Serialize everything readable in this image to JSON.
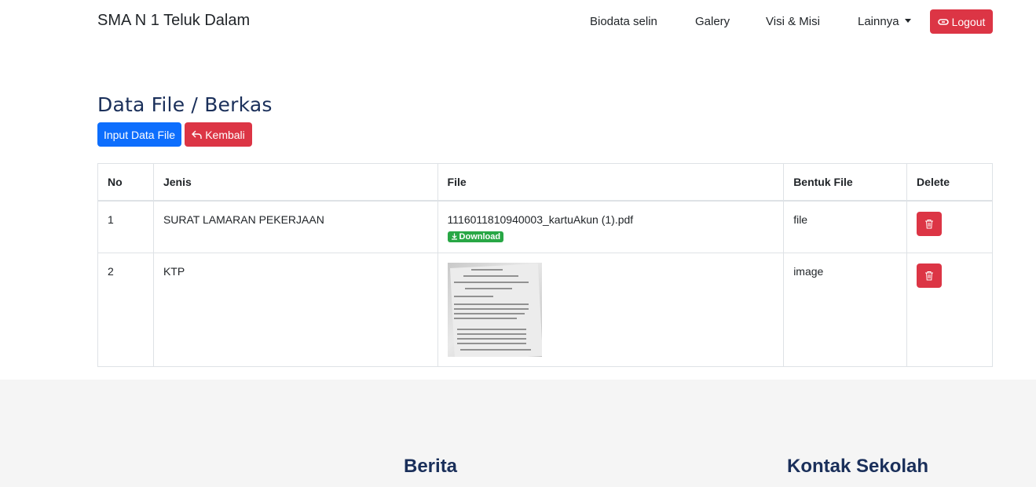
{
  "navbar": {
    "brand": "SMA N 1 Teluk Dalam",
    "links": [
      "Biodata selin",
      "Galery",
      "Visi & Misi",
      "Lainnya"
    ],
    "logout_label": "Logout"
  },
  "page": {
    "title": "Data File / Berkas",
    "input_button": "Input Data File",
    "back_button": "Kembali"
  },
  "table": {
    "headers": [
      "No",
      "Jenis",
      "File",
      "Bentuk File",
      "Delete"
    ],
    "rows": [
      {
        "no": "1",
        "jenis": "SURAT LAMARAN PEKERJAAN",
        "file": "1116011810940003_kartuAkun (1).pdf",
        "download_label": "Download",
        "bentuk": "file"
      },
      {
        "no": "2",
        "jenis": "KTP",
        "file": "",
        "bentuk": "image"
      }
    ]
  },
  "footer": {
    "berita": "Berita",
    "kontak": "Kontak Sekolah"
  },
  "colors": {
    "primary": "#0d6efd",
    "danger": "#dc3545",
    "success": "#28a745",
    "heading": "#1a2f5a"
  },
  "icons": [
    "link-icon",
    "undo-icon",
    "download-icon",
    "trash-icon",
    "caret-down-icon"
  ]
}
